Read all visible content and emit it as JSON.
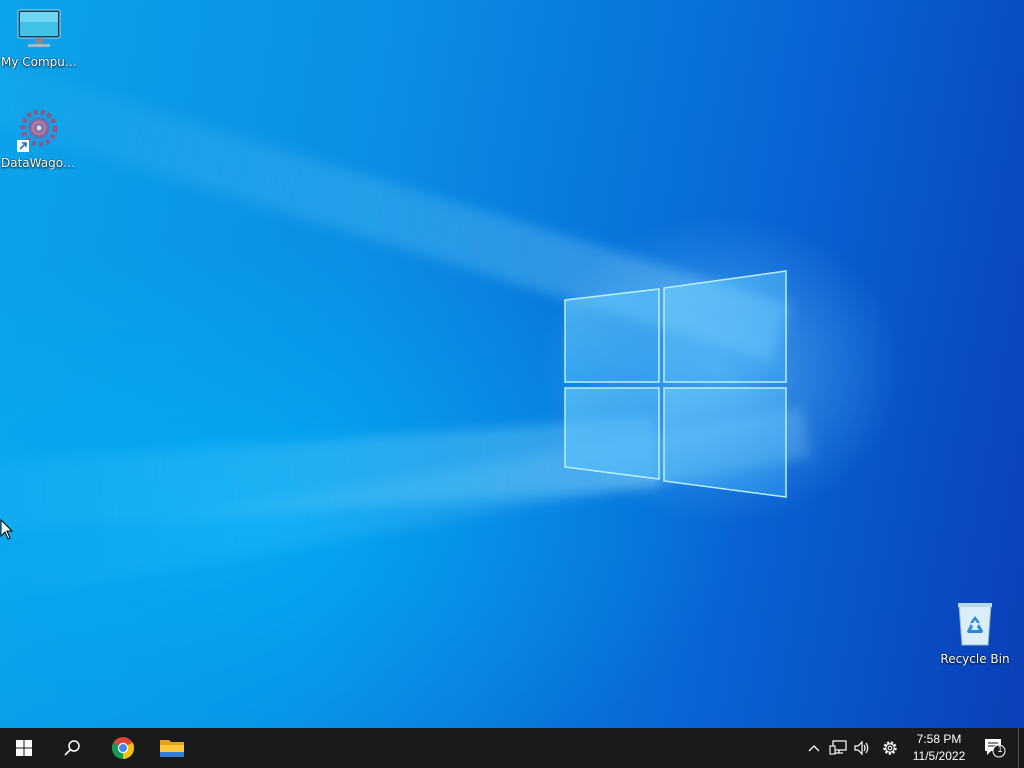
{
  "desktop": {
    "icons": [
      {
        "label": "My Computer",
        "icon": "monitor-icon"
      },
      {
        "label": "DataWagon...",
        "icon": "gear-app-icon"
      },
      {
        "label": "Recycle Bin",
        "icon": "recycle-bin-icon"
      }
    ],
    "wallpaper": {
      "primary": "#0a74da",
      "light": "#6fd0ff"
    }
  },
  "taskbar": {
    "start": {
      "icon": "windows-start-icon"
    },
    "search": {
      "icon": "search-icon"
    },
    "pinned": [
      {
        "name": "Google Chrome",
        "icon": "chrome-icon"
      },
      {
        "name": "File Explorer",
        "icon": "folder-icon"
      }
    ],
    "tray": {
      "icons": [
        "chevron-up-icon",
        "network-icon",
        "volume-icon",
        "settings-gear-icon"
      ],
      "time": "7:58 PM",
      "date": "11/5/2022",
      "notifications_count": "1"
    }
  }
}
